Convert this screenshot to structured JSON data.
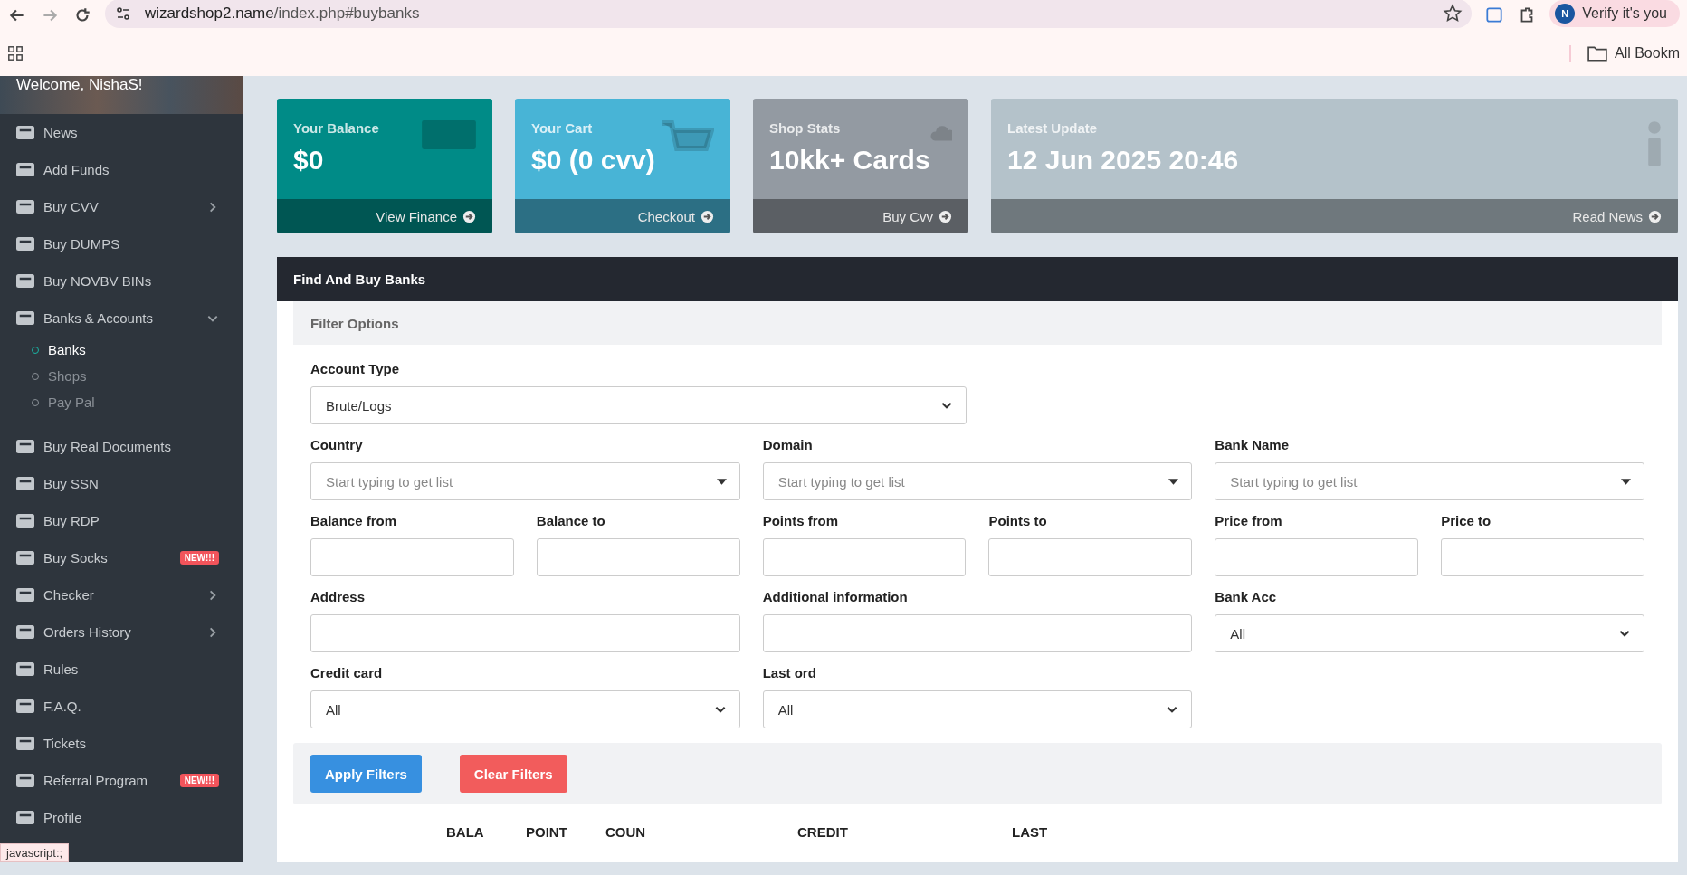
{
  "browser": {
    "url_host": "wizardshop2.name",
    "url_path": "/index.php#buybanks",
    "profile": {
      "initial": "N",
      "label": "Verify it's you"
    },
    "bookmarks": [
      "All Bookm"
    ],
    "status": "javascript:;"
  },
  "sidebar": {
    "welcome": "Welcome, NishaS!",
    "items": [
      {
        "label": "News"
      },
      {
        "label": "Add Funds"
      },
      {
        "label": "Buy CVV",
        "expanded": false
      },
      {
        "label": "Buy DUMPS"
      },
      {
        "label": "Buy NOVBV BINs"
      },
      {
        "label": "Banks & Accounts",
        "expanded": true,
        "children": [
          {
            "label": "Banks",
            "selected": true
          },
          {
            "label": "Shops",
            "selected": false
          },
          {
            "label": "Pay Pal",
            "selected": false
          }
        ]
      },
      {
        "label": "Buy Real Documents"
      },
      {
        "label": "Buy SSN"
      },
      {
        "label": "Buy RDP"
      },
      {
        "label": "Buy Socks",
        "badge": "NEW!!!"
      },
      {
        "label": "Checker",
        "expanded": false
      },
      {
        "label": "Orders History",
        "expanded": false
      },
      {
        "label": "Rules"
      },
      {
        "label": "F.A.Q."
      },
      {
        "label": "Tickets"
      },
      {
        "label": "Referral Program",
        "badge": "NEW!!!"
      },
      {
        "label": "Profile"
      }
    ]
  },
  "cards": [
    {
      "title": "Your Balance",
      "value": "$0",
      "link": "View Finance",
      "color": "#008b87"
    },
    {
      "title": "Your Cart",
      "value": "$0 (0 cvv)",
      "link": "Checkout",
      "color": "#48b4d6"
    },
    {
      "title": "Shop Stats",
      "value": "10kk+ Cards",
      "link": "Buy Cvv",
      "color": "#939aa2"
    },
    {
      "title": "Latest Update",
      "value": "12 Jun 2025 20:46",
      "link": "Read News",
      "color": "#b4c2ca"
    }
  ],
  "panel": {
    "title": "Find And Buy Banks",
    "filter_title": "Filter Options",
    "rows": [
      [
        {
          "kind": "select",
          "label": "Account Type",
          "value": "Brute/Logs"
        }
      ],
      [
        {
          "kind": "combo",
          "label": "Country",
          "placeholder": "Start typing to get list"
        },
        {
          "kind": "combo",
          "label": "Domain",
          "placeholder": "Start typing to get list"
        },
        {
          "kind": "combo",
          "label": "Bank Name",
          "placeholder": "Start typing to get list"
        }
      ],
      [
        {
          "kind": "range",
          "items": [
            {
              "label": "Balance from"
            },
            {
              "label": "Balance to"
            }
          ]
        },
        {
          "kind": "range",
          "items": [
            {
              "label": "Points from"
            },
            {
              "label": "Points to"
            }
          ]
        },
        {
          "kind": "range",
          "items": [
            {
              "label": "Price from"
            },
            {
              "label": "Price to"
            }
          ]
        }
      ],
      [
        {
          "kind": "input",
          "label": "Address"
        },
        {
          "kind": "input",
          "label": "Additional information"
        },
        {
          "kind": "select",
          "label": "Bank Acc",
          "value": "All"
        }
      ],
      [
        {
          "kind": "select",
          "label": "Credit card",
          "value": "All"
        },
        {
          "kind": "select",
          "label": "Last ord",
          "value": "All"
        }
      ]
    ],
    "buttons": [
      {
        "label": "Apply Filters",
        "kind": "primary"
      },
      {
        "label": "Clear Filters",
        "kind": "danger"
      }
    ],
    "table": {
      "columns": [
        "",
        "BALA",
        "POINT",
        "COUN",
        "CREDIT",
        "LAST"
      ]
    }
  }
}
